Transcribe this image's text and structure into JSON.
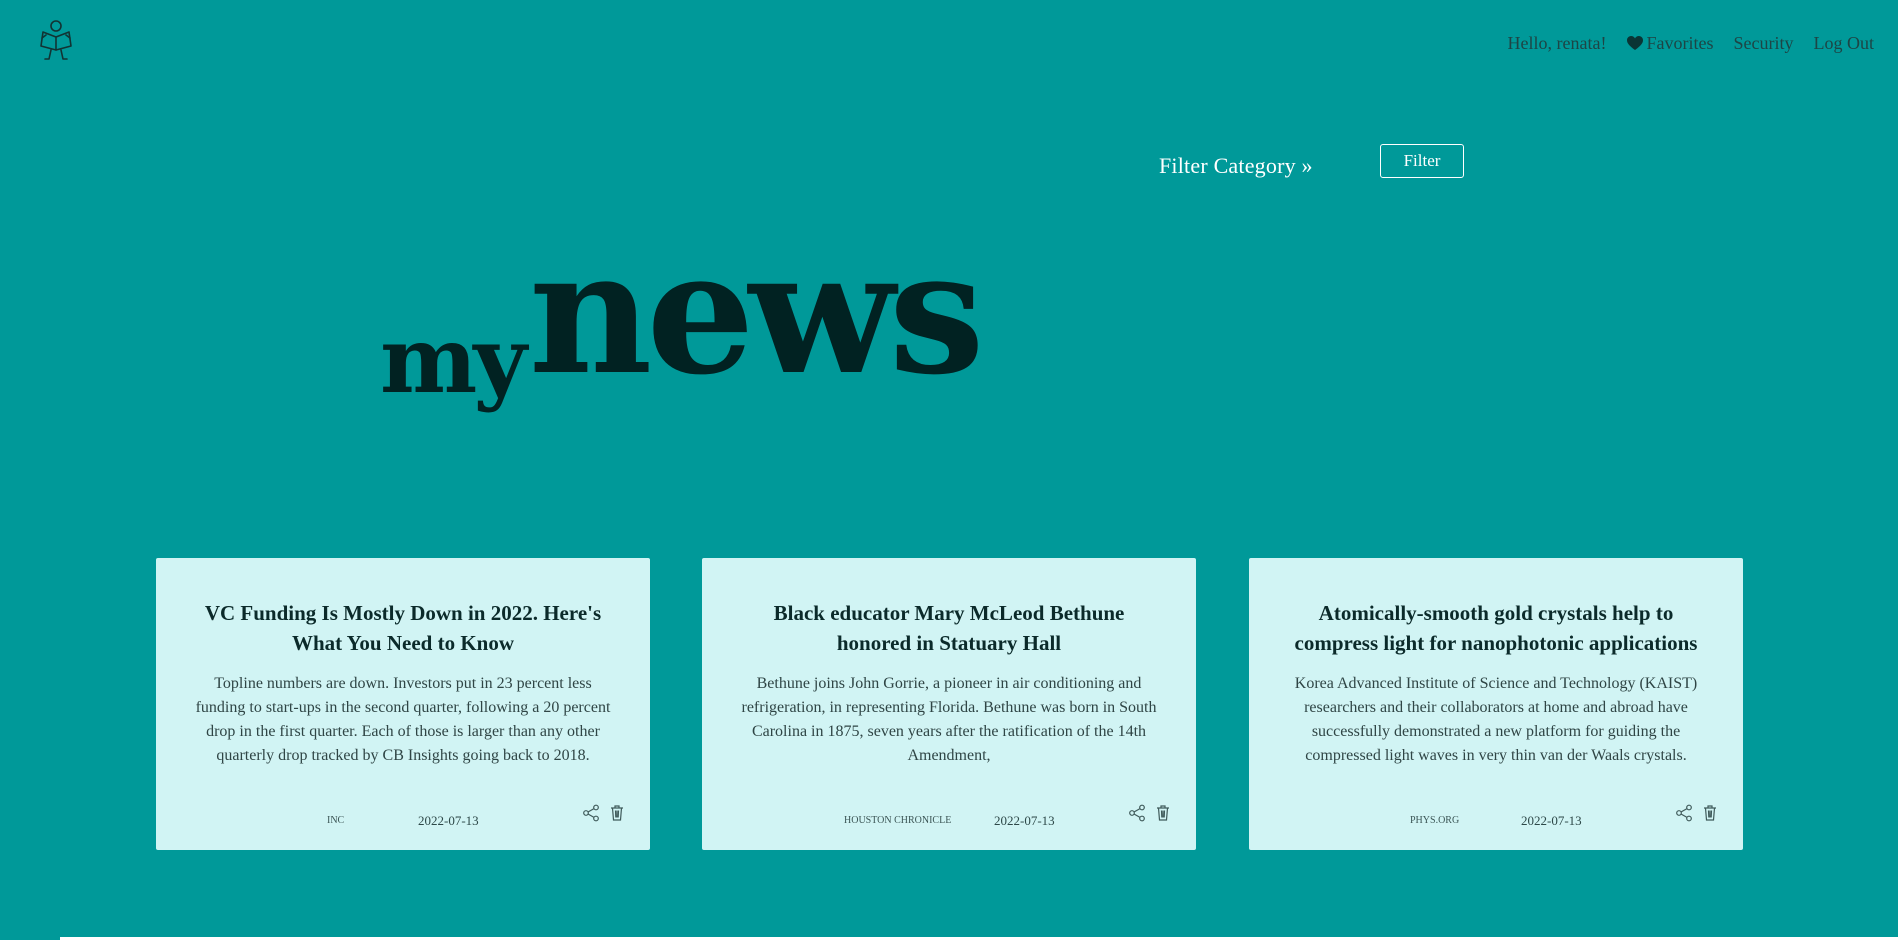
{
  "header": {
    "logo_icon": "reading-person-logo-icon",
    "greeting": "Hello, renata!",
    "favorites_label": "Favorites",
    "favorites_icon": "heart-icon",
    "security_label": "Security",
    "logout_label": "Log Out"
  },
  "filter": {
    "label": "Filter Category »",
    "button_label": "Filter"
  },
  "brand": {
    "prefix": "my",
    "main": "news"
  },
  "articles": [
    {
      "title": "VC Funding Is Mostly Down in 2022. Here's What You Need to Know",
      "description": "Topline numbers are down. Investors put in 23 percent less funding to start-ups in the second quarter, following a 20 percent drop in the first quarter. Each of those is larger than any other quarterly drop tracked by CB Insights going back to 2018.",
      "source": "INC",
      "date": "2022-07-13"
    },
    {
      "title": "Black educator Mary McLeod Bethune honored in Statuary Hall",
      "description": "Bethune joins John Gorrie, a pioneer in air conditioning and refrigeration, in representing Florida. Bethune was born in South Carolina in 1875, seven years after the ratification of the 14th Amendment,",
      "source": "HOUSTON CHRONICLE",
      "date": "2022-07-13"
    },
    {
      "title": "Atomically-smooth gold crystals help to compress light for nanophotonic applications",
      "description": "Korea Advanced Institute of Science and Technology (KAIST) researchers and their collaborators at home and abroad have successfully demonstrated a new platform for guiding the compressed light waves in very thin van der Waals crystals.",
      "source": "PHYS.ORG",
      "date": "2022-07-13"
    }
  ],
  "card_icons": [
    "share-icon",
    "trash-icon"
  ],
  "colors": {
    "background": "#009999",
    "card": "#d1f4f4",
    "brand_text": "#012222",
    "nav_text": "#1d4545"
  }
}
